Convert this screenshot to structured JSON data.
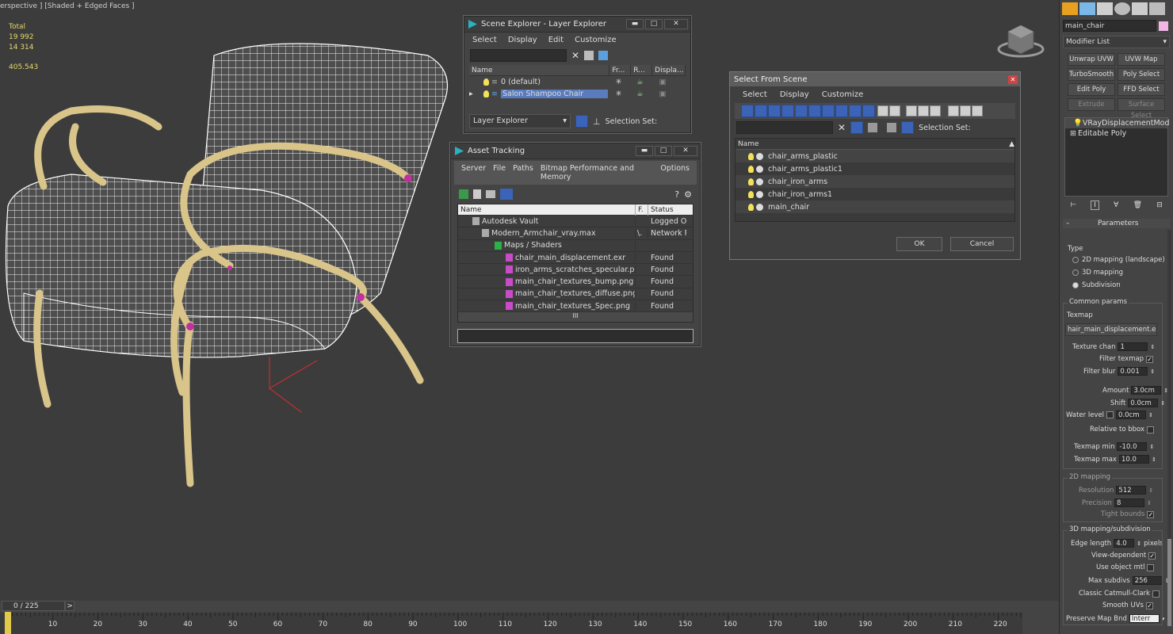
{
  "viewport": {
    "label": "erspective ] [Shaded + Edged Faces ]",
    "stats": {
      "total_label": "Total",
      "v1": "19 992",
      "v2": "14 314",
      "fps": "405.543"
    }
  },
  "layer_explorer": {
    "title": "Scene Explorer - Layer Explorer",
    "menu": [
      "Select",
      "Display",
      "Edit",
      "Customize"
    ],
    "columns": [
      "Name",
      "Fr...",
      "R...",
      "Displa..."
    ],
    "rows": [
      {
        "name": "0 (default)"
      },
      {
        "name": "Salon Shampoo Chair"
      }
    ],
    "footer_dropdown": "Layer Explorer",
    "footer_label": "Selection Set:"
  },
  "asset_tracking": {
    "title": "Asset Tracking",
    "menu": [
      "Server",
      "File",
      "Paths",
      "Bitmap Performance and Memory",
      "Options"
    ],
    "columns": [
      "Name",
      "F.",
      "Status"
    ],
    "rows": [
      {
        "name": "Autodesk Vault",
        "f": "",
        "status": "Logged O"
      },
      {
        "name": "Modern_Armchair_vray.max",
        "f": "\\.",
        "status": "Network F"
      },
      {
        "name": "Maps / Shaders",
        "f": "",
        "status": ""
      },
      {
        "name": "chair_main_displacement.exr",
        "f": "",
        "status": "Found"
      },
      {
        "name": "iron_arms_scratches_specular.png",
        "f": "",
        "status": "Found"
      },
      {
        "name": "main_chair_textures_bump.png",
        "f": "",
        "status": "Found"
      },
      {
        "name": "main_chair_textures_diffuse.png",
        "f": "",
        "status": "Found"
      },
      {
        "name": "main_chair_textures_Spec.png",
        "f": "",
        "status": "Found"
      }
    ],
    "scroll_label": "III"
  },
  "select_from_scene": {
    "title": "Select From Scene",
    "menu": [
      "Select",
      "Display",
      "Customize"
    ],
    "selection_set": "Selection Set:",
    "column": "Name",
    "items": [
      "chair_arms_plastic",
      "chair_arms_plastic1",
      "chair_iron_arms",
      "chair_iron_arms1",
      "main_chair"
    ],
    "ok": "OK",
    "cancel": "Cancel"
  },
  "command_panel": {
    "object_name": "main_chair",
    "modifier_list": "Modifier List",
    "buttons": [
      "Unwrap UVW",
      "UVW Map",
      "TurboSmooth",
      "Poly Select",
      "Edit Poly",
      "FFD Select",
      "Extrude",
      "Surface Select"
    ],
    "stack": [
      "VRayDisplacementMod",
      "Editable Poly"
    ],
    "rollout": "Parameters",
    "type_label": "Type",
    "type_options": [
      "2D mapping (landscape)",
      "3D mapping",
      "Subdivision"
    ],
    "common_params": "Common params",
    "texmap_label": "Texmap",
    "texmap_value": "hair_main_displacement.exr)",
    "texture_chan": {
      "label": "Texture chan",
      "value": "1"
    },
    "filter_texmap": "Filter texmap",
    "filter_blur": {
      "label": "Filter blur",
      "value": "0.001"
    },
    "amount": {
      "label": "Amount",
      "value": "3.0cm"
    },
    "shift": {
      "label": "Shift",
      "value": "0.0cm"
    },
    "water_level": {
      "label": "Water level",
      "value": "0.0cm"
    },
    "relative_bbox": "Relative to bbox",
    "texmap_min": {
      "label": "Texmap min",
      "value": "-10.0"
    },
    "texmap_max": {
      "label": "Texmap max",
      "value": "10.0"
    },
    "mapping2d": "2D mapping",
    "resolution": {
      "label": "Resolution",
      "value": "512"
    },
    "precision": {
      "label": "Precision",
      "value": "8"
    },
    "tight_bounds": "Tight bounds",
    "mapping3d": "3D mapping/subdivision",
    "edge_length": {
      "label": "Edge length",
      "value": "4.0",
      "unit": "pixels"
    },
    "view_dependent": "View-dependent",
    "use_object_mtl": "Use object mtl",
    "max_subdivs": {
      "label": "Max subdivs",
      "value": "256"
    },
    "classic_cc": "Classic Catmull-Clark",
    "smooth_uvs": "Smooth UVs",
    "preserve_map": {
      "label": "Preserve Map Bnd",
      "value": "Interr"
    }
  },
  "timeline": {
    "frame": "0 / 225",
    "next": ">",
    "ticks": [
      "10",
      "20",
      "30",
      "40",
      "50",
      "60",
      "70",
      "80",
      "90",
      "100",
      "110",
      "120",
      "130",
      "140",
      "150",
      "160",
      "170",
      "180",
      "190",
      "200",
      "210",
      "220"
    ]
  }
}
